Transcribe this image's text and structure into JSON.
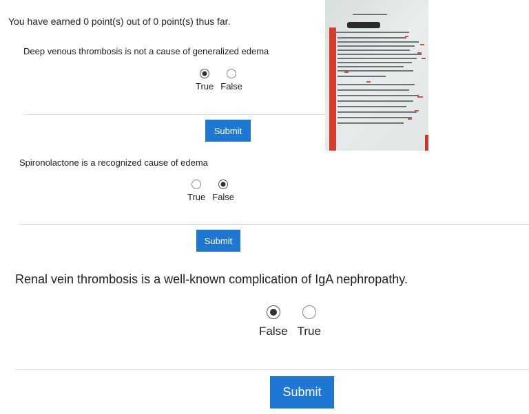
{
  "status_text": "You have earned 0 point(s) out of 0 point(s) thus far.",
  "questions": [
    {
      "text": "Deep venous thrombosis is not a cause of generalized edema",
      "options": [
        {
          "label": "True",
          "selected": true
        },
        {
          "label": "False",
          "selected": false
        }
      ],
      "submit_label": "Submit"
    },
    {
      "text": "Spironolactone is a recognized cause of edema",
      "options": [
        {
          "label": "True",
          "selected": false
        },
        {
          "label": "False",
          "selected": true
        }
      ],
      "submit_label": "Submit"
    },
    {
      "text": "Renal vein thrombosis is a well-known complication of IgA nephropathy.",
      "options": [
        {
          "label": "False",
          "selected": true
        },
        {
          "label": "True",
          "selected": false
        }
      ],
      "submit_label": "Submit"
    }
  ],
  "colors": {
    "button_bg": "#1f77d4",
    "button_text": "#ffffff",
    "divider": "#e3e3e3",
    "photo_marks": "#d93b2a"
  }
}
